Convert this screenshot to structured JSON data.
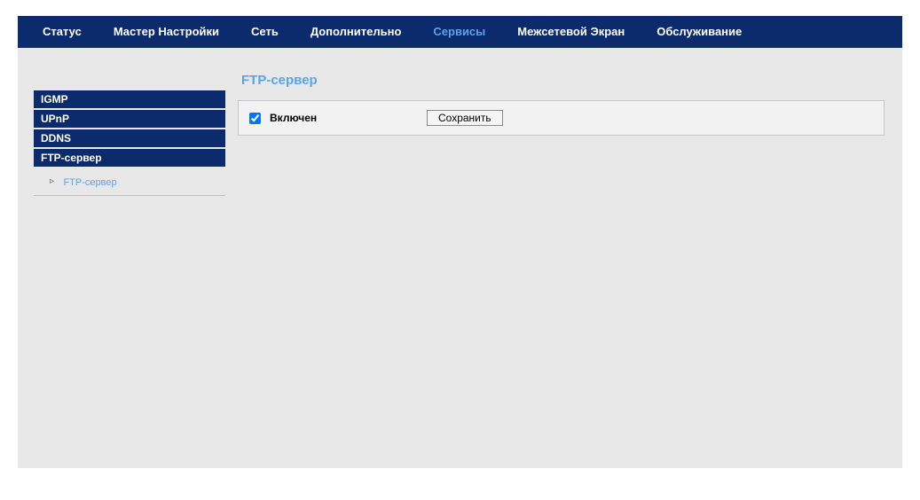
{
  "topnav": {
    "items": [
      {
        "label": "Статус",
        "active": false
      },
      {
        "label": "Мастер Настройки",
        "active": false
      },
      {
        "label": "Сеть",
        "active": false
      },
      {
        "label": "Дополнительно",
        "active": false
      },
      {
        "label": "Сервисы",
        "active": true
      },
      {
        "label": "Межсетевой Экран",
        "active": false
      },
      {
        "label": "Обслуживание",
        "active": false
      }
    ]
  },
  "sidebar": {
    "groups": [
      {
        "label": "IGMP"
      },
      {
        "label": "UPnP"
      },
      {
        "label": "DDNS"
      },
      {
        "label": "FTP-сервер"
      }
    ],
    "subitem": {
      "label": "FTP-сервер"
    }
  },
  "page": {
    "title": "FTP-сервер",
    "enable_label": "Включен",
    "enable_checked": true,
    "save_label": "Сохранить"
  }
}
